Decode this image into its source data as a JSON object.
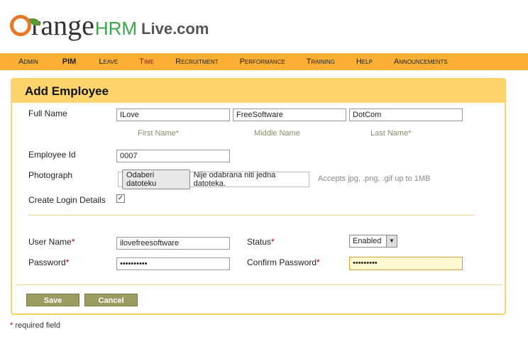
{
  "logo": {
    "text": "OrangeHRM Live.com",
    "w1": "range",
    "w2": "HRM",
    "w3": "Live.com"
  },
  "nav": [
    "Admin",
    "PIM",
    "Leave",
    "Time",
    "Recruitment",
    "Performance",
    "Training",
    "Help",
    "Announcements"
  ],
  "form": {
    "title": "Add Employee",
    "full_name_label": "Full Name",
    "first_name": "ILove",
    "middle_name": "FreeSoftware",
    "last_name": "DotCom",
    "first_name_label": "First Name*",
    "middle_name_label": "Middle Name",
    "last_name_label": "Last Name*",
    "employee_id_label": "Employee Id",
    "employee_id": "0007",
    "photograph_label": "Photograph",
    "file_button": "Odaberi datoteku",
    "file_status": "Nije odabrana niti jedna datoteka.",
    "file_hint": "Accepts jpg, .png, .gif up to 1MB",
    "create_login_label": "Create Login Details",
    "create_login_checked": true,
    "username_label": "User Name",
    "username": "ilovefreesoftware",
    "password_label": "Password",
    "password": "••••••••••",
    "status_label": "Status",
    "status": "Enabled",
    "confirm_password_label": "Confirm Password",
    "confirm_password": "•••••••••",
    "asterisk": "*",
    "save": "Save",
    "cancel": "Cancel"
  },
  "footer": {
    "asterisk": "*",
    "text": " required field"
  }
}
